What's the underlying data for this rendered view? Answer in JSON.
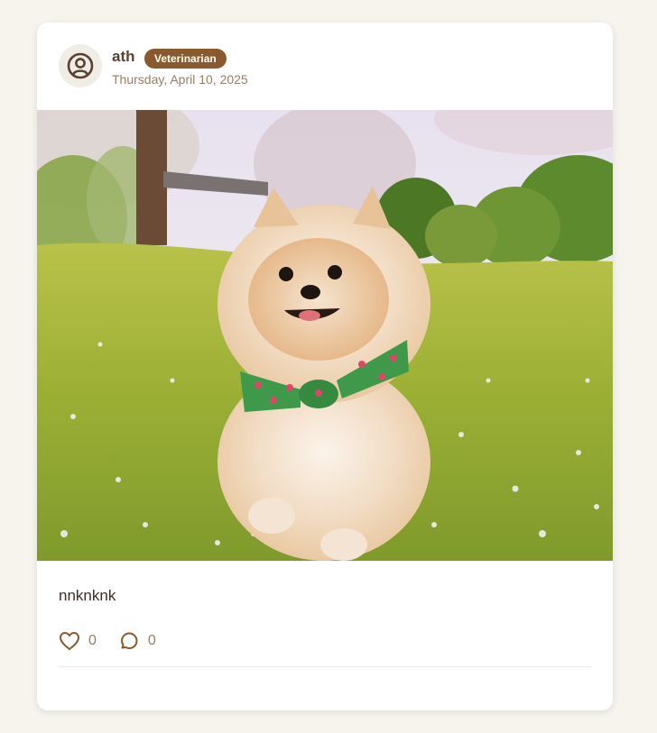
{
  "post": {
    "author": "ath",
    "role_badge": "Veterinarian",
    "date": "Thursday, April 10, 2025",
    "caption": "nnknknk",
    "likes": "0",
    "comments": "0",
    "image_description_icon": "pomeranian-photo"
  },
  "colors": {
    "page_bg": "#f7f4ee",
    "card_bg": "#ffffff",
    "brand_brown": "#8a5a2e",
    "muted_text": "#9a7c62"
  },
  "icons": {
    "avatar": "user-circle-icon",
    "like": "heart-icon",
    "comment": "comment-bubble-icon"
  }
}
